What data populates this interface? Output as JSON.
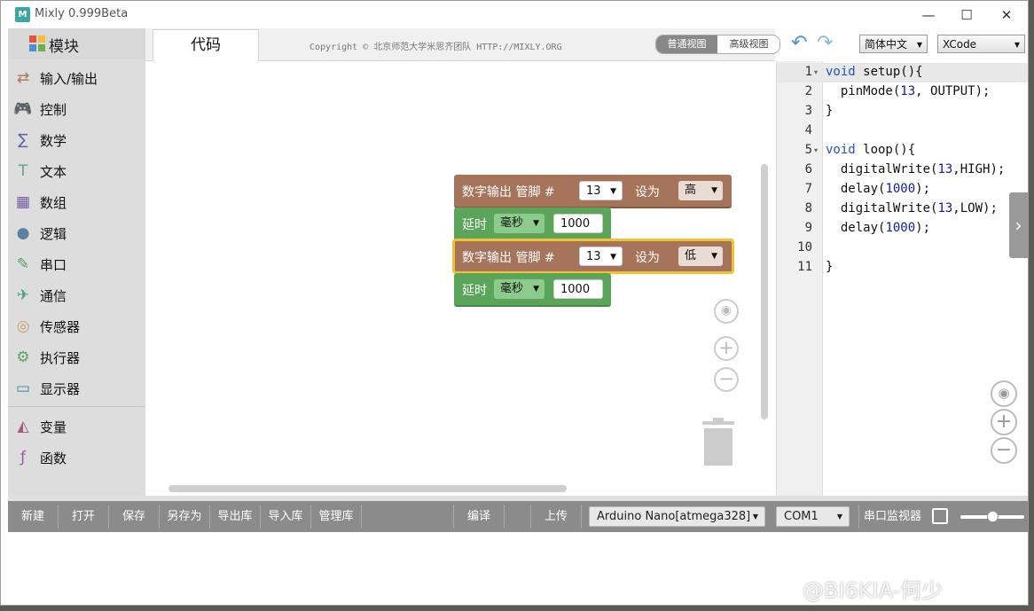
{
  "window": {
    "title": "Mixly 0.999Beta",
    "logo_text": "M",
    "minimize": "—",
    "maximize": "☐",
    "close": "✕"
  },
  "sidebar": {
    "header": "模块",
    "categories": [
      {
        "label": "输入/输出",
        "icon": "⇄",
        "color": "#a5745b"
      },
      {
        "label": "控制",
        "icon": "🎮",
        "color": "#5ba55b"
      },
      {
        "label": "数学",
        "icon": "∑",
        "color": "#5b67a5"
      },
      {
        "label": "文本",
        "icon": "T",
        "color": "#5ba58c"
      },
      {
        "label": "数组",
        "icon": "▦",
        "color": "#745ba5"
      },
      {
        "label": "逻辑",
        "icon": "●",
        "color": "#5b80a5"
      },
      {
        "label": "串口",
        "icon": "✎",
        "color": "#5ba55b"
      },
      {
        "label": "通信",
        "icon": "✈",
        "color": "#4a9a7a"
      },
      {
        "label": "传感器",
        "icon": "◎",
        "color": "#c8a060"
      },
      {
        "label": "执行器",
        "icon": "⚙",
        "color": "#5ba55b"
      },
      {
        "label": "显示器",
        "icon": "▭",
        "color": "#3a8aa5"
      },
      {
        "label": "变量",
        "icon": "◭",
        "color": "#a55b80"
      },
      {
        "label": "函数",
        "icon": "ƒ",
        "color": "#995ba5"
      }
    ]
  },
  "tabs": {
    "code_tab": "代码",
    "copyright": "Copyright © 北京师范大学米思齐团队 HTTP://MIXLY.ORG",
    "view_normal": "普通视图",
    "view_advanced": "高级视图",
    "language": "简体中文",
    "theme": "XCode"
  },
  "blocks": [
    {
      "type": "digital-write",
      "label_main": "数字输出 管脚 #",
      "pin": "13",
      "label_set": "设为",
      "value": "高"
    },
    {
      "type": "delay",
      "label_main": "延时",
      "unit": "毫秒",
      "value": "1000"
    },
    {
      "type": "digital-write",
      "label_main": "数字输出 管脚 #",
      "pin": "13",
      "label_set": "设为",
      "value": "低"
    },
    {
      "type": "delay",
      "label_main": "延时",
      "unit": "毫秒",
      "value": "1000"
    }
  ],
  "code": {
    "line_numbers": [
      "1",
      "2",
      "3",
      "4",
      "5",
      "6",
      "7",
      "8",
      "9",
      "10",
      "11"
    ],
    "lines": [
      "void setup(){",
      "  pinMode(13, OUTPUT);",
      "}",
      "",
      "void loop(){",
      "  digitalWrite(13,HIGH);",
      "  delay(1000);",
      "  digitalWrite(13,LOW);",
      "  delay(1000);",
      "",
      "}"
    ]
  },
  "bottom": {
    "new": "新建",
    "open": "打开",
    "save": "保存",
    "save_as": "另存为",
    "export_lib": "导出库",
    "import_lib": "导入库",
    "manage_lib": "管理库",
    "compile": "编译",
    "upload": "上传",
    "board": "Arduino Nano[atmega328]",
    "port": "COM1",
    "serial_monitor": "串口监视器"
  },
  "watermark": "@BI6KIA-何少"
}
